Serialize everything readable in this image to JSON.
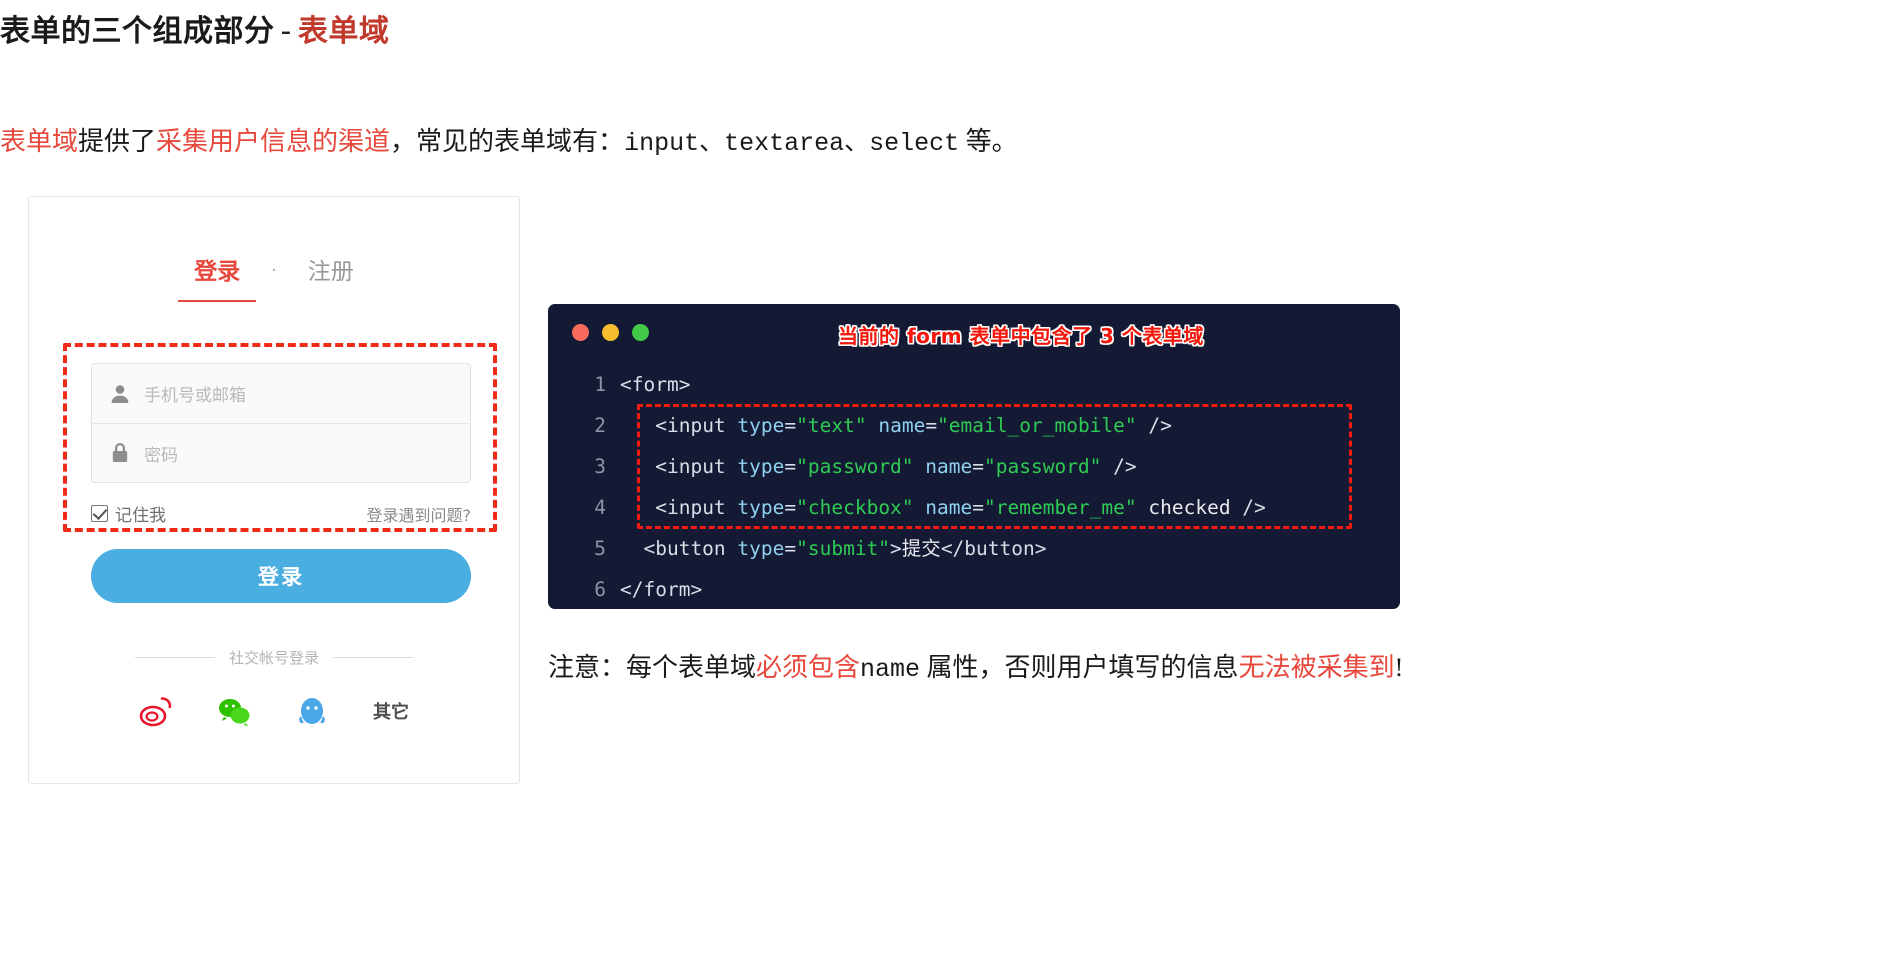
{
  "heading": {
    "main": "表单的三个组成部分",
    "dash": "-",
    "accent": "表单域"
  },
  "intro": {
    "p1_red": "表单域",
    "p2": "提供了",
    "p3_red": "采集用户信息的渠道",
    "p4": "，常见的表单域有：",
    "p5_mono": "input、textarea、select",
    "p6": " 等。"
  },
  "login_card": {
    "tabs": {
      "active": "登录",
      "separator": "·",
      "inactive": "注册"
    },
    "fields": [
      {
        "icon": "user-icon",
        "placeholder": "手机号或邮箱"
      },
      {
        "icon": "lock-icon",
        "placeholder": "密码"
      }
    ],
    "remember": {
      "checked": true,
      "label": "记住我",
      "help_link": "登录遇到问题?"
    },
    "submit_label": "登录",
    "social": {
      "divider_label": "社交帐号登录",
      "icons": [
        {
          "name": "weibo-icon",
          "color": "#e6162d"
        },
        {
          "name": "wechat-icon",
          "color": "#2dc100"
        },
        {
          "name": "qq-icon",
          "color": "#4aa8e8"
        }
      ],
      "other_label": "其它"
    }
  },
  "code_panel": {
    "window_dots": [
      "#f96a5d",
      "#f7bd2e",
      "#43c948"
    ],
    "annotation": "当前的 form 表单中包含了 3 个表单域",
    "lines": [
      {
        "no": "1",
        "tokens": [
          {
            "t": "tag",
            "v": "<form>"
          }
        ]
      },
      {
        "no": "2",
        "tokens": [
          {
            "t": "txt",
            "v": "   "
          },
          {
            "t": "tag",
            "v": "<input "
          },
          {
            "t": "attr",
            "v": "type"
          },
          {
            "t": "eq",
            "v": "="
          },
          {
            "t": "val",
            "v": "\"text\""
          },
          {
            "t": "txt",
            "v": " "
          },
          {
            "t": "attr",
            "v": "name"
          },
          {
            "t": "eq",
            "v": "="
          },
          {
            "t": "val",
            "v": "\"email_or_mobile\""
          },
          {
            "t": "tag",
            "v": " />"
          }
        ]
      },
      {
        "no": "3",
        "tokens": [
          {
            "t": "txt",
            "v": "   "
          },
          {
            "t": "tag",
            "v": "<input "
          },
          {
            "t": "attr",
            "v": "type"
          },
          {
            "t": "eq",
            "v": "="
          },
          {
            "t": "val",
            "v": "\"password\""
          },
          {
            "t": "txt",
            "v": " "
          },
          {
            "t": "attr",
            "v": "name"
          },
          {
            "t": "eq",
            "v": "="
          },
          {
            "t": "val",
            "v": "\"password\""
          },
          {
            "t": "tag",
            "v": " />"
          }
        ]
      },
      {
        "no": "4",
        "tokens": [
          {
            "t": "txt",
            "v": "   "
          },
          {
            "t": "tag",
            "v": "<input "
          },
          {
            "t": "attr",
            "v": "type"
          },
          {
            "t": "eq",
            "v": "="
          },
          {
            "t": "val",
            "v": "\"checkbox\""
          },
          {
            "t": "txt",
            "v": " "
          },
          {
            "t": "attr",
            "v": "name"
          },
          {
            "t": "eq",
            "v": "="
          },
          {
            "t": "val",
            "v": "\"remember_me\""
          },
          {
            "t": "txt",
            "v": " checked"
          },
          {
            "t": "tag",
            "v": " />"
          }
        ]
      },
      {
        "no": "5",
        "tokens": [
          {
            "t": "txt",
            "v": "  "
          },
          {
            "t": "tag",
            "v": "<button "
          },
          {
            "t": "attr",
            "v": "type"
          },
          {
            "t": "eq",
            "v": "="
          },
          {
            "t": "val",
            "v": "\"submit\""
          },
          {
            "t": "tag",
            "v": ">"
          },
          {
            "t": "txt",
            "v": "提交"
          },
          {
            "t": "tag",
            "v": "</button>"
          }
        ]
      },
      {
        "no": "6",
        "tokens": [
          {
            "t": "tag",
            "v": "</form>"
          }
        ]
      }
    ]
  },
  "note": {
    "n1": "注意：每个表单域",
    "n2_red": "必须包含",
    "n3_mono": "name",
    "n4": " 属性，否则用户填写的信息",
    "n5_red": "无法被采集到",
    "n6": "!"
  },
  "colors": {
    "accent_red": "#e8483c",
    "highlight_red": "#ef2b18",
    "code_bg": "#141a33",
    "button_blue": "#4aaee0"
  }
}
